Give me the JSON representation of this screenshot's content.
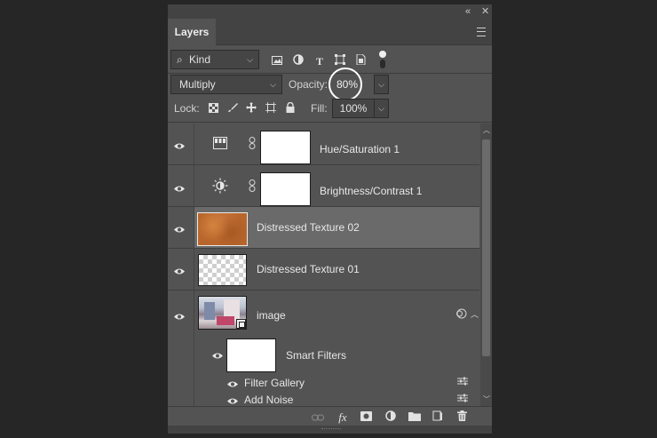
{
  "panel": {
    "title": "Layers",
    "collapse_glyph": "«",
    "close_glyph": "✕"
  },
  "filter": {
    "kind_label": "Kind",
    "search_glyph": "⌕",
    "icons": [
      "image-filter-icon",
      "adjustment-filter-icon",
      "type-filter-icon",
      "shape-filter-icon",
      "smart-object-filter-icon"
    ]
  },
  "blend": {
    "mode": "Multiply",
    "opacity_label": "Opacity:",
    "opacity_value": "80%"
  },
  "lock": {
    "label": "Lock:",
    "fill_label": "Fill:",
    "fill_value": "100%"
  },
  "layers": [
    {
      "name": "Hue/Saturation 1",
      "type": "adjustment",
      "icon": "hue-saturation-icon",
      "visible": true,
      "selected": false
    },
    {
      "name": "Brightness/Contrast 1",
      "type": "adjustment",
      "icon": "brightness-contrast-icon",
      "visible": true,
      "selected": false
    },
    {
      "name": "Distressed Texture 02",
      "type": "pixel",
      "thumb": "orange-texture",
      "visible": true,
      "selected": true
    },
    {
      "name": "Distressed Texture 01",
      "type": "pixel",
      "thumb": "transparent",
      "visible": true,
      "selected": false
    },
    {
      "name": "image",
      "type": "smart-object",
      "thumb": "photo",
      "visible": true,
      "selected": false
    }
  ],
  "smart_filters": {
    "label": "Smart Filters",
    "items": [
      "Filter Gallery",
      "Add Noise"
    ]
  },
  "footer_icons": [
    "link-layers-icon",
    "fx-icon",
    "add-mask-icon",
    "new-adjustment-icon",
    "new-group-icon",
    "new-layer-icon",
    "delete-layer-icon"
  ],
  "colors": {
    "panel_bg": "#535353",
    "selected_row": "#6a6a6a",
    "app_bg": "#262626"
  }
}
